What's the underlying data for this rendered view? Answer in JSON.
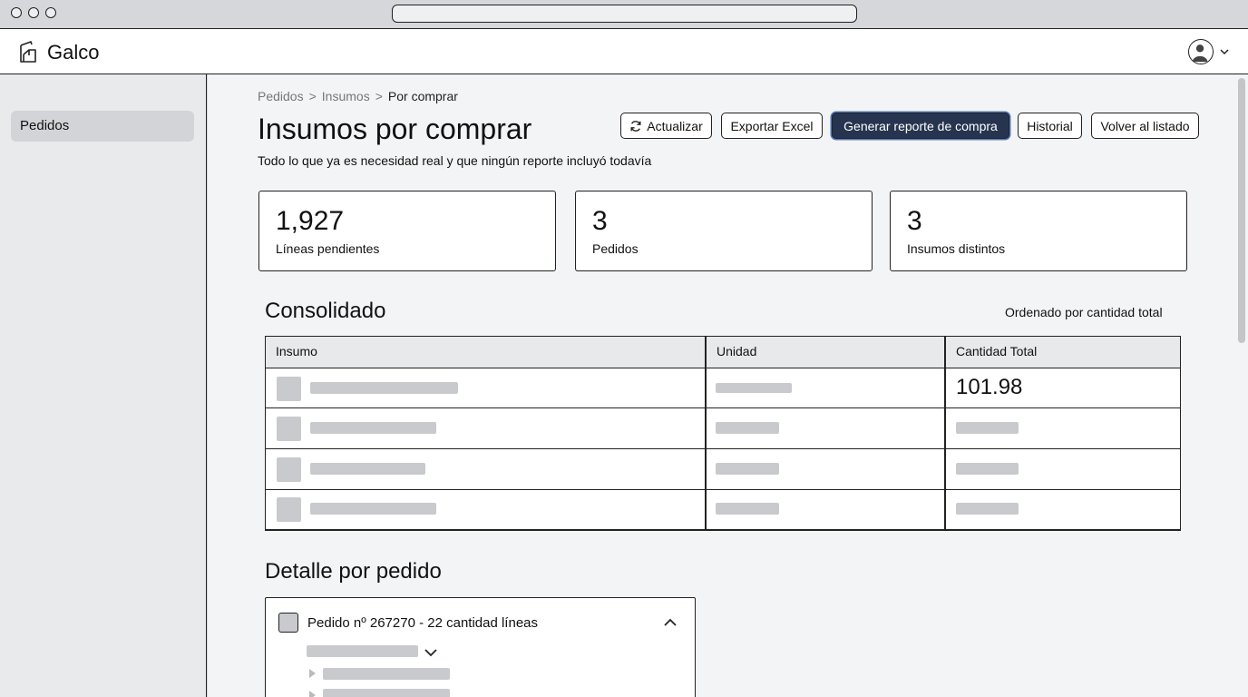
{
  "app": {
    "brand": "Galco"
  },
  "sidebar": {
    "items": [
      {
        "label": "Pedidos"
      }
    ]
  },
  "breadcrumb": {
    "items": [
      "Pedidos",
      "Insumos",
      "Por comprar"
    ],
    "separator": ">"
  },
  "page": {
    "title": "Insumos por comprar",
    "subtitle": "Todo lo que ya es necesidad real y que ningún reporte incluyó todavía"
  },
  "toolbar": {
    "refresh_label": "Actualizar",
    "export_label": "Exportar Excel",
    "generate_label": "Generar reporte de compra",
    "history_label": "Historial",
    "back_label": "Volver al listado"
  },
  "stats": [
    {
      "value": "1,927",
      "label": "Líneas pendientes"
    },
    {
      "value": "3",
      "label": "Pedidos"
    },
    {
      "value": "3",
      "label": "Insumos distintos"
    }
  ],
  "consolidated": {
    "title": "Consolidado",
    "sort_note": "Ordenado por cantidad total",
    "columns": [
      "Insumo",
      "Unidad",
      "Cantidad Total"
    ],
    "rows": [
      {
        "cantidad": "101.98"
      },
      {
        "cantidad": ""
      },
      {
        "cantidad": ""
      },
      {
        "cantidad": ""
      }
    ]
  },
  "detail": {
    "title": "Detalle por pedido",
    "order_label": "Pedido nº 267270 - 22 cantidad líneas"
  },
  "colors": {
    "primary": "#26344f",
    "placeholder": "#c9cacd",
    "sidebar_bg": "#e9eaec",
    "main_bg": "#f3f4f5"
  },
  "icons": [
    "logo-icon",
    "avatar-icon",
    "chevron-down-icon",
    "refresh-icon",
    "chevron-up-icon",
    "caret-right-icon"
  ]
}
